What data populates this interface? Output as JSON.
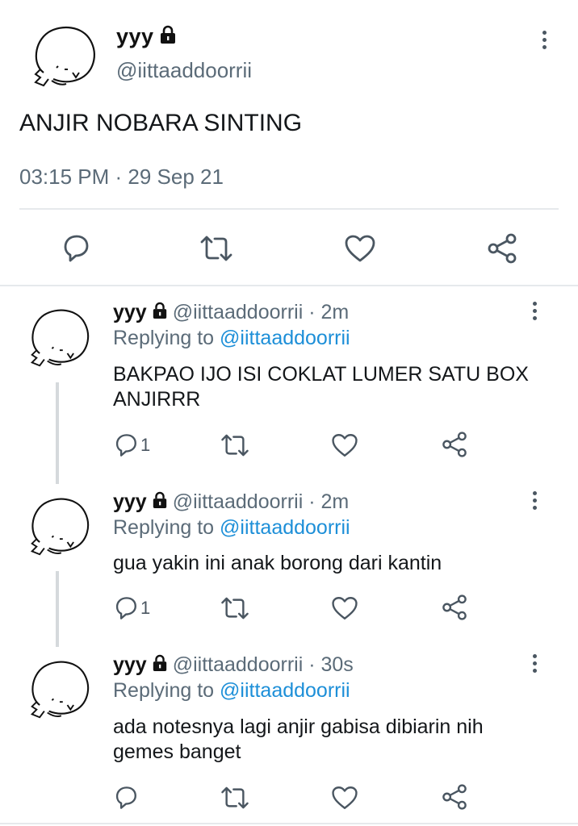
{
  "main_tweet": {
    "display_name": "yyy",
    "handle": "@iittaaddoorrii",
    "text": "ANJIR NOBARA SINTING",
    "timestamp": "03:15 PM · 29 Sep 21",
    "icons": {
      "reply": "reply-icon",
      "retweet": "retweet-icon",
      "like": "like-icon",
      "share": "share-icon",
      "more": "more-vertical-icon",
      "lock": "lock-icon"
    }
  },
  "replies": [
    {
      "display_name": "yyy",
      "handle": "@iittaaddoorrii · 2m",
      "replying_prefix": "Replying to",
      "replying_to": "@iittaaddoorrii",
      "text": "BAKPAO IJO ISI COKLAT LUMER SATU BOX ANJIRRR",
      "reply_count": "1"
    },
    {
      "display_name": "yyy",
      "handle": "@iittaaddoorrii · 2m",
      "replying_prefix": "Replying to",
      "replying_to": "@iittaaddoorrii",
      "text": "gua yakin ini anak borong dari kantin",
      "reply_count": "1"
    },
    {
      "display_name": "yyy",
      "handle": "@iittaaddoorrii · 30s",
      "replying_prefix": "Replying to",
      "replying_to": "@iittaaddoorrii",
      "text": "ada notesnya lagi anjir gabisa dibiarin nih gemes banget",
      "reply_count": ""
    }
  ],
  "colors": {
    "accent": "#1d8fd8",
    "secondary_text": "#5b6b78",
    "icon": "#4a5661",
    "divider": "#e6e9ec"
  }
}
